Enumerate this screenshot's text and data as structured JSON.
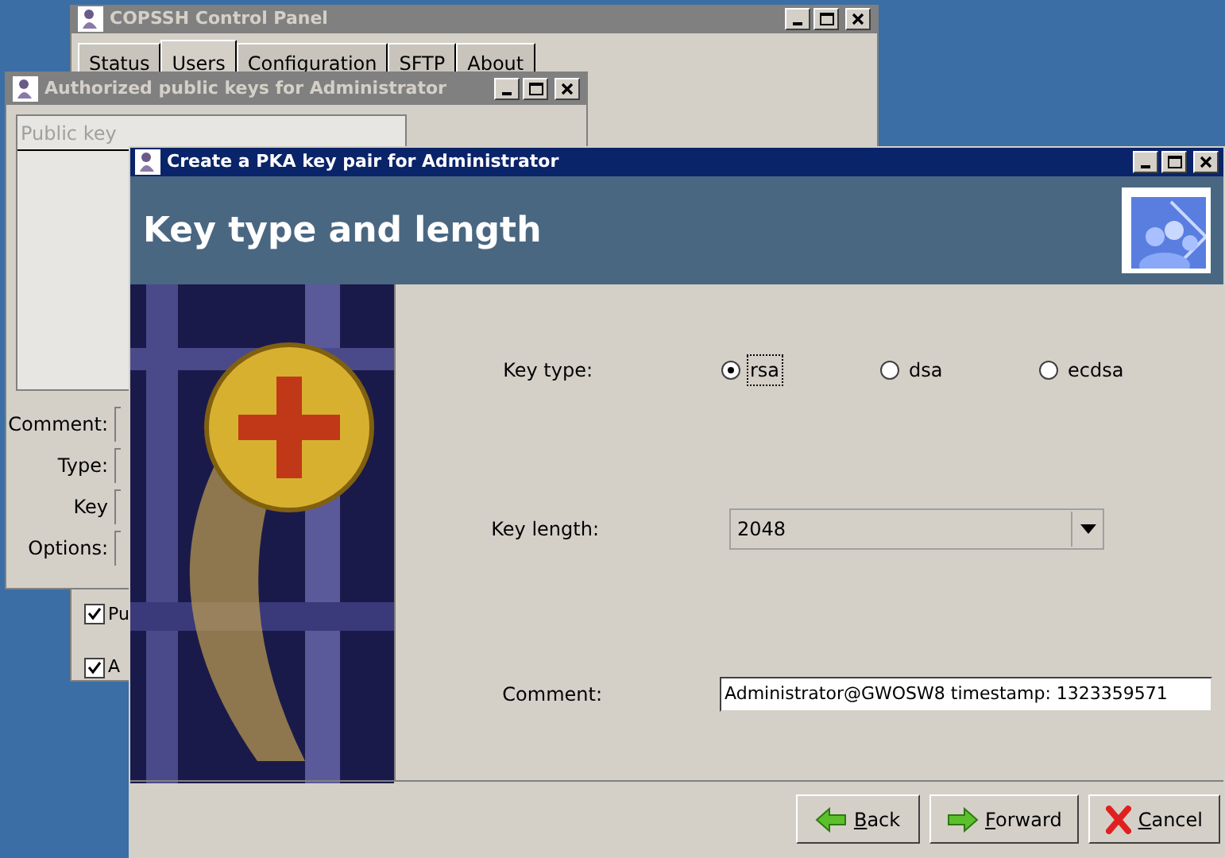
{
  "control_panel": {
    "title": "COPSSH Control Panel",
    "tabs": [
      {
        "label": "Status",
        "selected": false
      },
      {
        "label": "Users",
        "selected": true
      },
      {
        "label": "Configuration",
        "selected": false
      },
      {
        "label": "SFTP",
        "selected": false
      },
      {
        "label": "About",
        "selected": false
      }
    ],
    "checkboxes": [
      {
        "label": "Pu",
        "checked": true
      },
      {
        "label": "A",
        "checked": true
      }
    ]
  },
  "keys_window": {
    "title": "Authorized public keys for Administrator",
    "column": "Public key",
    "fields": [
      "Comment:",
      "Type:",
      "Key",
      "Options:"
    ]
  },
  "wizard": {
    "title": "Create a PKA key pair for Administrator",
    "heading": "Key type and length",
    "key_type_label": "Key type:",
    "key_types": [
      {
        "label": "rsa",
        "selected": true
      },
      {
        "label": "dsa",
        "selected": false
      },
      {
        "label": "ecdsa",
        "selected": false
      }
    ],
    "key_length_label": "Key length:",
    "key_length": "2048",
    "comment_label": "Comment:",
    "comment": "Administrator@GWOSW8 timestamp: 1323359571",
    "buttons": [
      {
        "label": "Back",
        "kind": "back"
      },
      {
        "label": "Forward",
        "kind": "forward"
      },
      {
        "label": "Cancel",
        "kind": "cancel"
      }
    ]
  }
}
